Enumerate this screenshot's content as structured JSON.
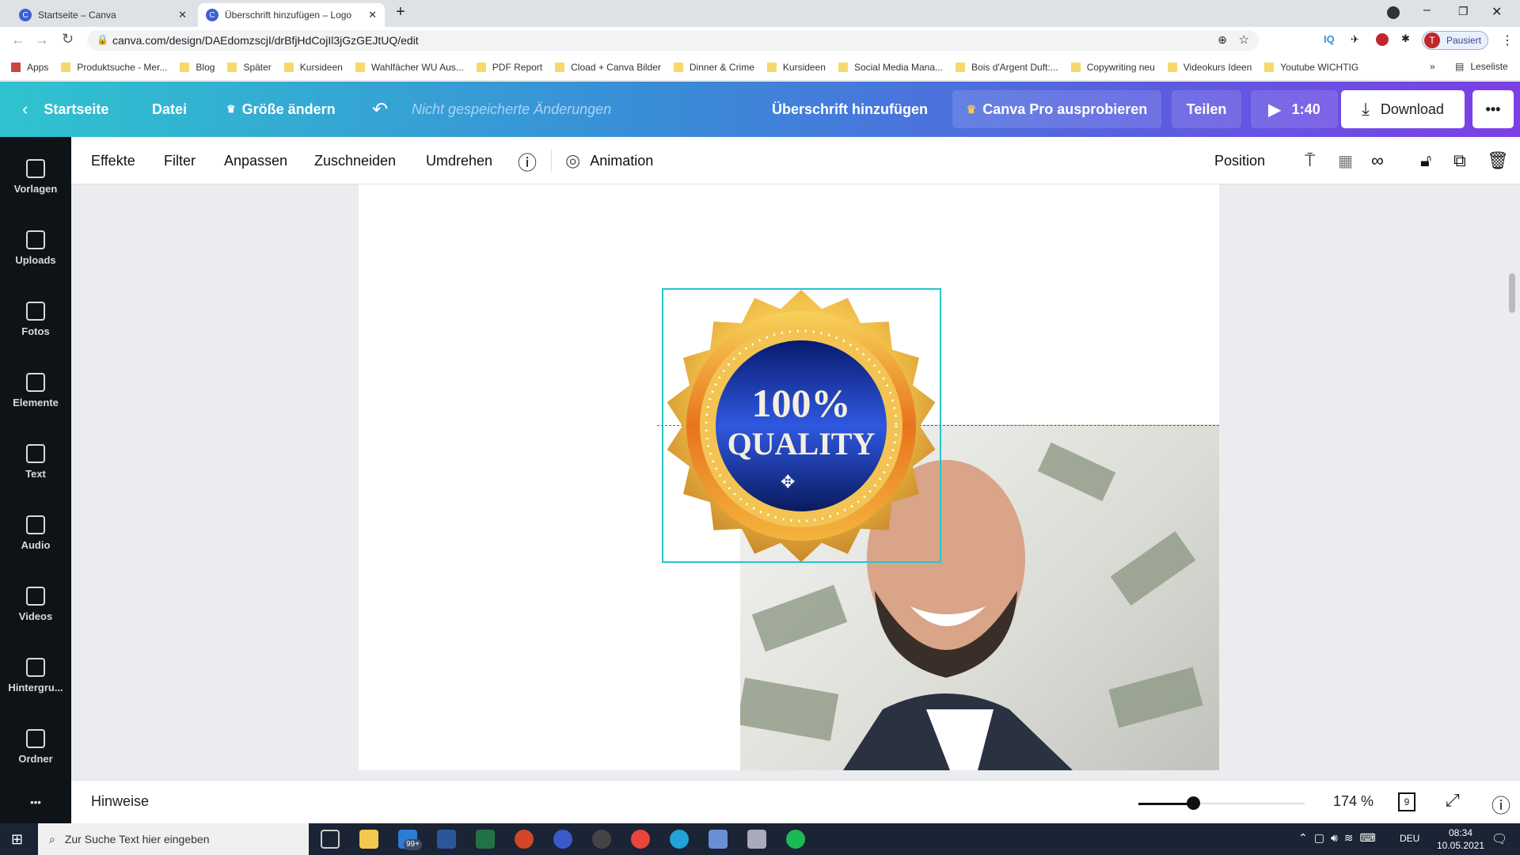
{
  "browser": {
    "tabs": [
      {
        "label": "Startseite – Canva"
      },
      {
        "label": "Überschrift hinzufügen – Logo"
      }
    ],
    "url": "canva.com/design/DAEdomzscjI/drBfjHdCojIl3jGzGEJtUQ/edit",
    "profile_label": "Pausiert",
    "profile_initial": "T",
    "bookmarks": [
      "Apps",
      "Produktsuche - Mer...",
      "Blog",
      "Später",
      "Kursideen",
      "Wahlfächer WU Aus...",
      "PDF Report",
      "Cload + Canva Bilder",
      "Dinner & Crime",
      "Kursideen",
      "Social Media Mana...",
      "Bois d'Argent Duft:...",
      "Copywriting neu",
      "Videokurs Ideen",
      "Youtube WICHTIG"
    ],
    "reading_list": "Leseliste"
  },
  "header": {
    "home": "Startseite",
    "file": "Datei",
    "resize": "Größe ändern",
    "unsaved": "Nicht gespeicherte Änderungen",
    "title": "Überschrift hinzufügen",
    "pro": "Canva Pro ausprobieren",
    "share": "Teilen",
    "play_time": "1:40",
    "download": "Download",
    "more": "•••"
  },
  "toolbar": {
    "items": [
      "Effekte",
      "Filter",
      "Anpassen",
      "Zuschneiden",
      "Umdrehen"
    ],
    "animation": "Animation",
    "position": "Position"
  },
  "sidebar": {
    "items": [
      "Vorlagen",
      "Uploads",
      "Fotos",
      "Elemente",
      "Text",
      "Audio",
      "Videos",
      "Hintergru...",
      "Ordner"
    ]
  },
  "canvas": {
    "badge_line1": "100%",
    "badge_line2": "QUALITY"
  },
  "bottom": {
    "notes": "Hinweise",
    "zoom": "174 %",
    "zoom_fraction": 0.33,
    "pages": "9"
  },
  "taskbar": {
    "search_placeholder": "Zur Suche Text hier eingeben",
    "lang": "DEU",
    "time": "08:34",
    "date": "10.05.2021",
    "mail_badge": "99+"
  },
  "colors": {
    "accent": "#00c4cc",
    "sidebar": "#0e1318",
    "header_start": "#2fc3cf",
    "header_end": "#7d3fe6"
  }
}
